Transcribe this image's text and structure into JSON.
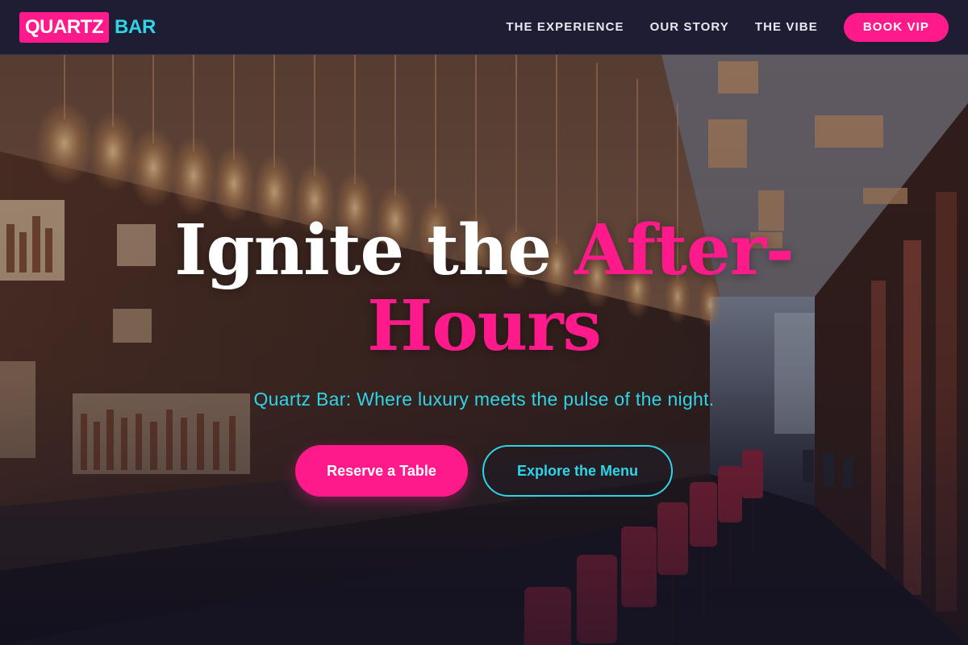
{
  "brand": {
    "name": "QUARTZ",
    "accent": "BAR"
  },
  "nav": {
    "links": [
      {
        "label": "THE EXPERIENCE"
      },
      {
        "label": "OUR STORY"
      },
      {
        "label": "THE VIBE"
      }
    ],
    "cta": "BOOK VIP"
  },
  "hero": {
    "headline_white": "Ignite the ",
    "headline_pink_1": "After-",
    "headline_pink_2": "Hours",
    "tagline": "Quartz Bar: Where luxury meets the pulse of the night.",
    "primary_button": "Reserve a Table",
    "secondary_button": "Explore the Menu"
  },
  "colors": {
    "pink": "#ff1a8c",
    "cyan": "#2fd4e6",
    "header_bg": "#1f1d33"
  }
}
